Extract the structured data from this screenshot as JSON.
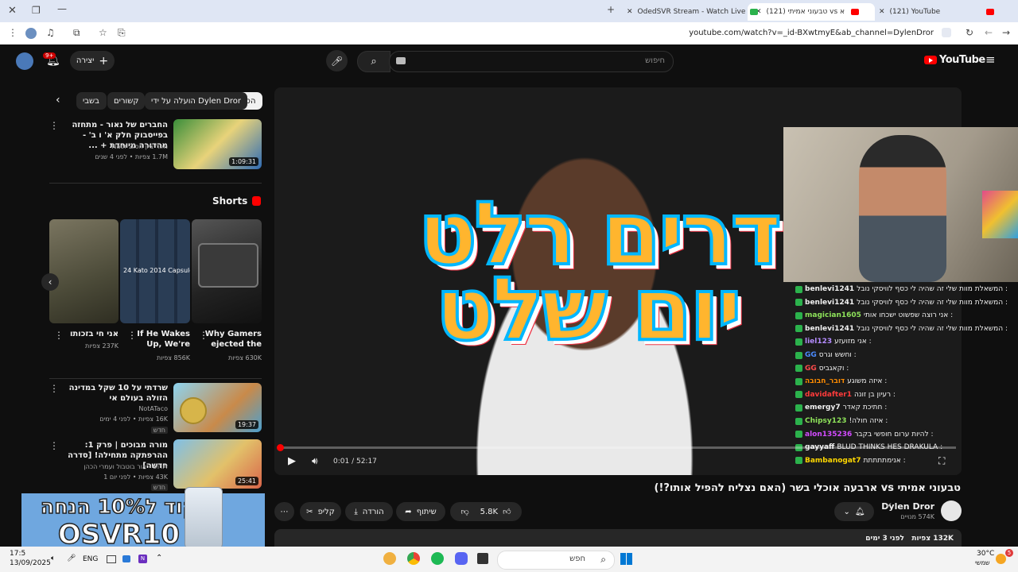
{
  "browser": {
    "tabs": [
      {
        "label": "(121) YouTube"
      },
      {
        "label": "(121) טבעוני אמיתי vs ארבעה א"
      },
      {
        "label": "OdedSVR Stream - Watch Live"
      }
    ],
    "url": "youtube.com/watch?v=_id-BXwtmyE&ab_channel=DylenDror"
  },
  "masthead": {
    "logo": "YouTube",
    "search_placeholder": "חיפוש",
    "create_label": "יצירה",
    "notifications_count": "9+"
  },
  "chips": [
    "הכל",
    "הועלה על ידי Dylen Dror",
    "קשורים",
    "בשבי"
  ],
  "sidebar": {
    "videos": [
      {
        "title": "החברים של נאור - מתחזה בפייסבוק חלק א' ו ב' - מהדורה מיוחדת + ...",
        "channel": "נאור ציון Naor Zion",
        "meta": "1.7M צפיות • לפני 4 שנים",
        "duration": "1:09:31"
      }
    ],
    "shorts_title": "Shorts",
    "shorts": [
      {
        "title": "Why Gamers ejected the",
        "views": "630K צפיות"
      },
      {
        "title": "If He Wakes Up, We're",
        "views": "856K צפיות"
      },
      {
        "title": "אני חי בזכותו",
        "views": "237K צפיות"
      }
    ],
    "shorts_overlay": "24 Kato 2014 Capsules",
    "videos2": [
      {
        "title": "שרדתי על 10 שקל במדינה הזולה בעולם אי",
        "channel": "NotATaco",
        "meta": "16K צפיות • לפני 4 ימים",
        "badge": "חדש",
        "duration": "19:37"
      },
      {
        "title": "מורה מבוכים | פרק 1: ההרפתקה מתחילה! [סדרה חדשה]",
        "channel": "דודוש - אור בוטבול ועמרי הכהן",
        "meta": "43K צפיות • לפני יום 1",
        "badge": "חדש",
        "duration": "25:41"
      }
    ]
  },
  "player": {
    "time": "0:01 / 52:17",
    "overlay_line1": "דרים רלט",
    "overlay_line2": "יום שלט"
  },
  "chat": [
    {
      "name": "benlevi1241",
      "text": ": המשאלת מוות שלי זה שהיה לי כסף לוויסקי נובל",
      "color": "#f1f1f1"
    },
    {
      "name": "benlevi1241",
      "text": ": המשאלת מוות שלי זה שהיה לי כסף לוויסקי נובל",
      "color": "#f1f1f1"
    },
    {
      "name": "magician1605",
      "text": ": אני רוצה שפשוט ישכחו אותי",
      "color": "#8ee35a"
    },
    {
      "name": "benlevi1241",
      "text": ": המשאלת מוות שלי זה שהיה לי כסף לוויסקי נובל",
      "color": "#f1f1f1"
    },
    {
      "name": "liel123",
      "text": ": אני מזועזע",
      "color": "#b48cff"
    },
    {
      "name": "GG",
      "text": ": וחשש וגרס",
      "color": "#4b8bff"
    },
    {
      "name": "GG",
      "text": ": וקאגביס",
      "color": "#ff4b4b"
    },
    {
      "name": "דובר_חבובה",
      "text": ": איזה משוגע",
      "color": "#ff8c00"
    },
    {
      "name": "davidafter1",
      "text": ": רעיון בן זונה",
      "color": "#ff3b3b"
    },
    {
      "name": "emergy7",
      "text": ": חתיכת קאדר",
      "color": "#f1f1f1"
    },
    {
      "name": "Chipsy123",
      "text": ": איזה חולה!",
      "color": "#8ee35a"
    },
    {
      "name": "alon135236",
      "text": ": להיות ערום חופשי בקבר",
      "color": "#d24bff"
    },
    {
      "name": "gayyaff",
      "text": ": BLUD THINKS HES DRAKULA",
      "color": "#f1f1f1"
    },
    {
      "name": "Bambanogat7",
      "text": ": אנימתתתתת",
      "color": "#ffd700"
    }
  ],
  "video": {
    "title": "טבעוני אמיתי vs ארבעה אוכלי בשר (האם נצליח להפיל אותו?!)",
    "channel": "Dylen Dror",
    "subscribers": "574K מנויים",
    "likes": "5.8K",
    "share": "שיתוף",
    "download": "הורדה",
    "clip": "קליפ",
    "views": "132K צפיות",
    "date": "לפני 3 ימים"
  },
  "promo": {
    "line1": "קוד ל10% הנחה",
    "line2": "OSVR10"
  },
  "taskbar": {
    "search": "חפש",
    "lang": "ENG",
    "time": "17:5",
    "date": "13/09/2025",
    "weather": "30°C",
    "weather_desc": "שמשי",
    "notif": "5"
  }
}
